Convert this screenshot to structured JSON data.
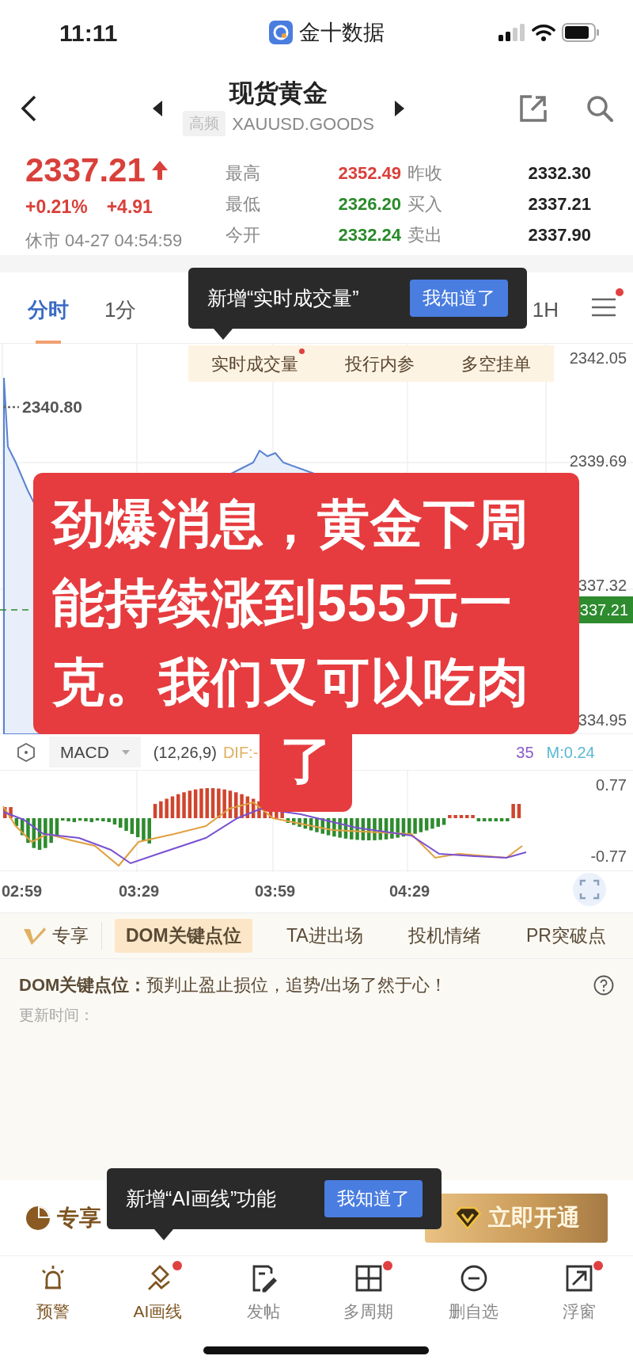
{
  "status_bar": {
    "time": "11:11",
    "app_name": "金十数据"
  },
  "header": {
    "title": "现货黄金",
    "badge": "高频",
    "symbol": "XAUUSD.GOODS"
  },
  "quote": {
    "price": "2337.21",
    "change_percent": "+0.21%",
    "change": "+4.91",
    "market_status": "休市 04-27 04:54:59"
  },
  "stats": [
    {
      "label": "最高",
      "value": "2352.49",
      "color": "#d9403a"
    },
    {
      "label": "昨收",
      "value": "2332.30",
      "color": "#222222"
    },
    {
      "label": "最低",
      "value": "2326.20",
      "color": "#2a8a2a"
    },
    {
      "label": "买入",
      "value": "2337.21",
      "color": "#222222"
    },
    {
      "label": "今开",
      "value": "2332.24",
      "color": "#2a8a2a"
    },
    {
      "label": "卖出",
      "value": "2337.90",
      "color": "#222222"
    }
  ],
  "period_tabs": [
    {
      "label": "分时",
      "selected": true
    },
    {
      "label": "1分",
      "selected": false
    },
    {
      "label": "1H",
      "selected": false
    }
  ],
  "period_menu": {
    "dot": true
  },
  "tooltips": [
    {
      "text": "新增“实时成交量”",
      "button": "我知道了"
    },
    {
      "text": "新增“AI画线”功能",
      "button": "我知道了"
    }
  ],
  "chart": {
    "subtabs": [
      {
        "label": "实时成交量",
        "dot": true
      },
      {
        "label": "投行内参",
        "dot": false
      },
      {
        "label": "多空挂单",
        "dot": false
      }
    ],
    "price_labels": [
      "2342.05",
      "2339.69",
      "337.32",
      "334.95"
    ],
    "high_label": "2340.80",
    "last_price": "337.21"
  },
  "indicator": {
    "name": "MACD",
    "params": "(12,26,9)",
    "dif": "DIF:-",
    "dea": "35",
    "m": "M:0.24",
    "labels": [
      "0.77",
      "-0.77"
    ]
  },
  "time_axis": [
    "02:59",
    "03:29",
    "03:59",
    "04:29"
  ],
  "sticker": {
    "lines": [
      "劲爆消息，黄金下周",
      "能持续涨到555元一",
      "克。我们又可以吃肉"
    ],
    "tail": "了"
  },
  "panel": {
    "brand": "专享",
    "tabs": [
      {
        "label": "DOM关键点位",
        "selected": true
      },
      {
        "label": "TA进出场",
        "selected": false
      },
      {
        "label": "投机情绪",
        "selected": false
      },
      {
        "label": "PR突破点",
        "selected": false
      }
    ],
    "headline": "**DOM关键点位：**预判止盈止损位，追势/出场了然于心！",
    "updated": "更新时间："
  },
  "promo": {
    "text": "专享",
    "button": "立即开通"
  },
  "bottom_nav": [
    {
      "label": "预警",
      "dot": false,
      "color": "#7d5420"
    },
    {
      "label": "AI画线",
      "dot": true,
      "color": "#7d5420"
    },
    {
      "label": "发帖",
      "dot": false,
      "color": "#333333"
    },
    {
      "label": "多周期",
      "dot": true,
      "color": "#333333"
    },
    {
      "label": "删自选",
      "dot": false,
      "color": "#333333"
    },
    {
      "label": "浮窗",
      "dot": true,
      "color": "#333333"
    }
  ]
}
